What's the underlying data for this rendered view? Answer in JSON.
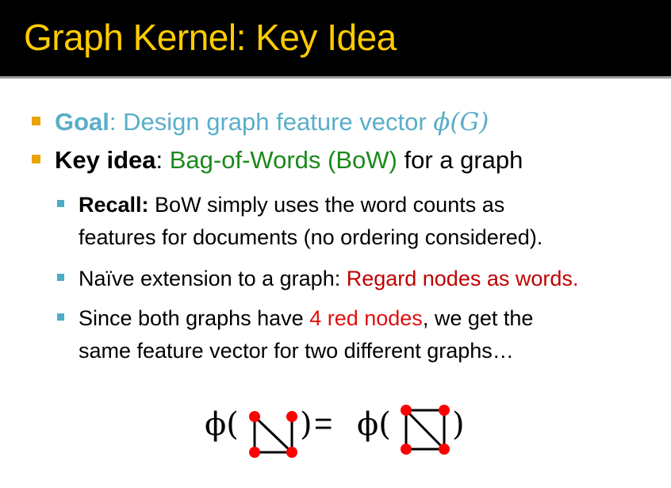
{
  "title": "Graph Kernel: Key Idea",
  "bullets": {
    "goal": {
      "label": "Goal",
      "rest": ": Design graph feature vector ",
      "math": "ϕ(G)"
    },
    "key": {
      "label": "Key idea",
      "sep": ": ",
      "highlight": "Bag-of-Words (BoW)",
      "rest": " for a graph"
    },
    "recall": {
      "label": "Recall:",
      "line1": " BoW simply uses the word counts as",
      "line2": "features for documents (no ordering considered)."
    },
    "naive": {
      "text": "Naïve extension to a graph: ",
      "highlight": "Regard nodes as words."
    },
    "since": {
      "pre": "Since both graphs have ",
      "highlight": "4 red nodes",
      "post": ", we get the",
      "line2": "same feature vector for two different graphs…"
    }
  },
  "formula": {
    "phi": "ϕ(",
    "close": ")",
    "equals": " = "
  },
  "colors": {
    "title": "#ffcc00",
    "node": "#ff0000"
  }
}
